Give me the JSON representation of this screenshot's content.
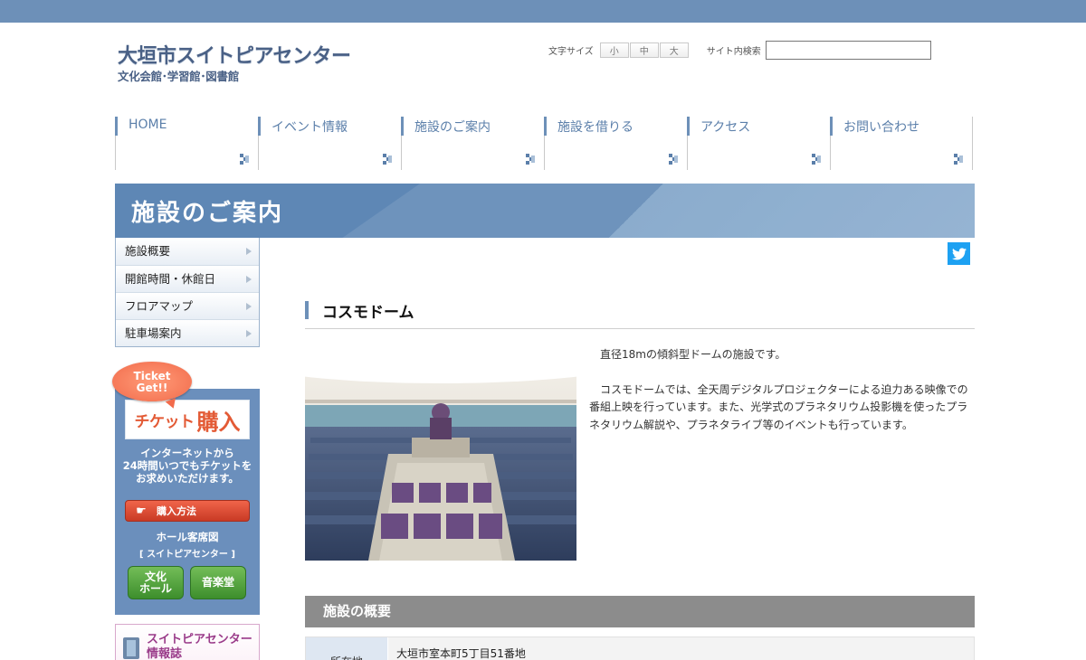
{
  "site": {
    "title": "大垣市スイトピアセンター",
    "subtitle": "文化会館･学習館･図書館"
  },
  "header": {
    "font_size_label": "文字サイズ",
    "font_sizes": [
      "小",
      "中",
      "大"
    ],
    "search_label": "サイト内検索",
    "search_value": ""
  },
  "gnav": [
    {
      "label": "HOME"
    },
    {
      "label": "イベント情報"
    },
    {
      "label": "施設のご案内"
    },
    {
      "label": "施設を借りる"
    },
    {
      "label": "アクセス"
    },
    {
      "label": "お問い合わせ"
    }
  ],
  "banner": {
    "title": "施設のご案内"
  },
  "sidenav": [
    {
      "label": "施設概要"
    },
    {
      "label": "開館時間・休館日"
    },
    {
      "label": "フロアマップ"
    },
    {
      "label": "駐車場案内"
    }
  ],
  "ticket": {
    "bubble_line1": "Ticket",
    "bubble_line2": "Get!!",
    "buy_small": "チケット",
    "buy_big": "購入",
    "text_line1": "インターネットから",
    "text_line2": "24時間いつでもチケットを",
    "text_line3": "お求めいただけます。",
    "howto_label": "購入方法",
    "seat_title": "ホール客席図",
    "seat_sub": "[ スイトピアセンター ]",
    "hall1_line1": "文化",
    "hall1_line2": "ホール",
    "hall2": "音楽堂"
  },
  "info_mag": {
    "line1": "スイトピアセンター",
    "line2": "情報誌"
  },
  "content": {
    "heading": "コスモドーム",
    "para1": "直径18mの傾斜型ドームの施設です。",
    "para2": "コスモドームでは、全天周デジタルプロジェクターによる迫力ある映像での番組上映を行っています。また、光学式のプラネタリウム投影機を使ったプラネタリウム解説や、プラネタライブ等のイベントも行っています。",
    "overview_heading": "施設の概要",
    "table": [
      {
        "label": "所在地",
        "value": "大垣市室本町5丁目51番地"
      }
    ]
  },
  "colors": {
    "topbar": "#6d90b8",
    "accent": "#5b7faa",
    "twitter": "#1da1f2",
    "ticket_bg": "#6b8fbc",
    "overview_bg": "#8c8c8c"
  },
  "icons": {
    "twitter": "twitter-icon",
    "nav_arrow": "pixel-arrow-icon",
    "hand": "pointing-hand-icon",
    "book": "book-icon"
  }
}
